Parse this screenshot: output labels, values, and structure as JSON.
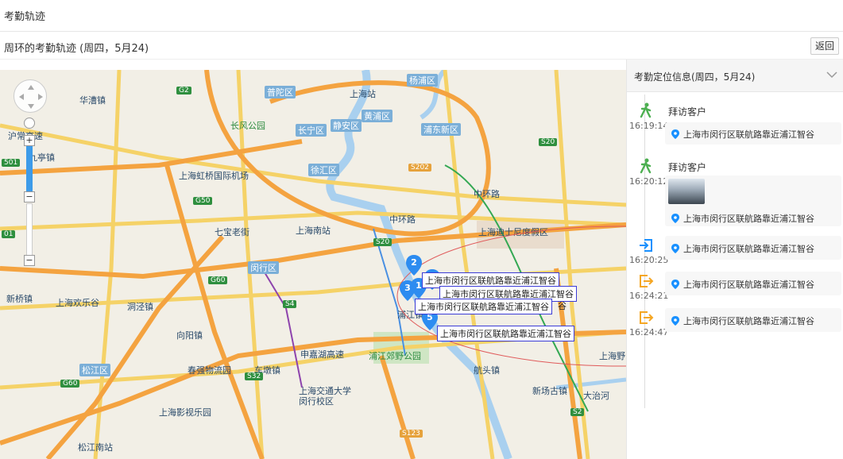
{
  "header": {
    "title": "考勤轨迹"
  },
  "subheader": {
    "subtitle": "周环的考勤轨迹 (周四，5月24)",
    "back_label": "返回"
  },
  "map": {
    "labels": {
      "putuo": "普陀区",
      "yangpu": "杨浦区",
      "shanghai_station": "上海站",
      "changfeng": "长风公园",
      "changning": "长宁区",
      "jingan": "静安区",
      "huangpu": "黄浦区",
      "pudong": "浦东新区",
      "hongqiao": "上海虹桥国际机场",
      "xuhui": "徐汇区",
      "qibao": "七宝老街",
      "shanghai_south": "上海南站",
      "disney": "上海迪士尼度假区",
      "minhang": "闵行区",
      "happy_valley": "上海欢乐谷",
      "songjiang": "松江区",
      "songjiang_south": "松江南站",
      "chunshen": "春强物流园",
      "sjtu": "上海交通大学闵行校区",
      "film_park": "上海影视乐园",
      "pujiang_park": "浦江郊野公园",
      "xinchang": "新场古镇",
      "dazhihe": "大治河",
      "huajing": "华泾镇",
      "pujiang": "浦江镇",
      "zhongshan": "中环路",
      "zhonghuan": "中环路",
      "hangtou": "航头镇",
      "jiading": "沪常高速",
      "xinqiao": "新桥镇",
      "dongjing": "洞泾镇",
      "xiangcheng": "向阳镇",
      "huacao": "华漕镇",
      "jiuting": "九亭镇",
      "chedun": "车墩镇",
      "shenjiang": "申嘉湖高速",
      "shanghai_wild": "上海野"
    },
    "road_tags": {
      "g2": "G2",
      "s20a": "S20",
      "s20b": "S20",
      "g50": "G50",
      "s202": "S202",
      "g60a": "G60",
      "g60b": "G60",
      "s4": "S4",
      "s32": "S32",
      "s123": "S123",
      "s2": "S2",
      "s501": "501",
      "s01": "01"
    },
    "pin_labels": [
      "上海市闵行区联航路靠近浦江智谷",
      "上海市闵行区联航路靠近浦江智谷",
      "上海市闵行区联航路靠近浦江智谷",
      "上海市闵行区联航路靠近浦江智谷"
    ],
    "pin_overflow_text": "谷",
    "pins": [
      "1",
      "2",
      "3",
      "4",
      "5"
    ]
  },
  "panel": {
    "title": "考勤定位信息(周四，5月24)",
    "entries": [
      {
        "type": "visit",
        "title": "拜访客户",
        "time": "16:19:14",
        "address": "上海市闵行区联航路靠近浦江智谷"
      },
      {
        "type": "visit",
        "title": "拜访客户",
        "time": "16:20:12",
        "address": "上海市闵行区联航路靠近浦江智谷"
      },
      {
        "type": "checkin",
        "time": "16:20:25",
        "address": "上海市闵行区联航路靠近浦江智谷"
      },
      {
        "type": "checkout",
        "time": "16:24:21",
        "address": "上海市闵行区联航路靠近浦江智谷"
      },
      {
        "type": "checkout",
        "time": "16:24:47",
        "address": "上海市闵行区联航路靠近浦江智谷"
      }
    ]
  },
  "colors": {
    "accent": "#1890ff",
    "visit_green": "#4caf50",
    "checkout_orange": "#f5a623",
    "map_bg": "#f2efe6"
  }
}
